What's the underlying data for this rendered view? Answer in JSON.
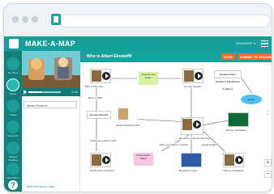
{
  "app": {
    "title": "MAKE-A-MAP",
    "map_title": "Who is Albert Einstein?",
    "buttons": {
      "save": "SAVE",
      "submit": "SUBMIT TO TEACHER"
    },
    "topbar_right": "BRAINPOP ▾"
  },
  "left_panel": {
    "video_time": "2:34",
    "search_value": "Albert Einstein",
    "add_to_map": "Add Movies to map"
  },
  "rail": [
    {
      "label": "My Maps"
    },
    {
      "label": "Movie"
    },
    {
      "label": "Images"
    },
    {
      "label": "Keywords"
    },
    {
      "label": "Related Reading"
    },
    {
      "label": "Word Bank"
    }
  ],
  "nodes": [
    {
      "text": "Born in Germany"
    },
    {
      "text": "physicist and author"
    },
    {
      "text": "his own theories"
    },
    {
      "text": "General Relativity"
    },
    {
      "text": "Special Relativity"
    },
    {
      "text": "Photoelectric Effect"
    },
    {
      "text": "Brownian motion"
    },
    {
      "text": "Theory of Relativity"
    },
    {
      "text": "Nobel Prize in Physics"
    },
    {
      "text": "Einstein's Quantum Theories"
    },
    {
      "text": "Energy and Matter"
    }
  ],
  "notes": [
    {
      "text": "physicist and author"
    },
    {
      "text": "Einstein's Nobel Prize"
    },
    {
      "text": "Photoelectric Effect"
    }
  ],
  "links": [
    {
      "text": "Born in 1879"
    },
    {
      "text": "taught himself physics"
    },
    {
      "text": "worked as a patent clerk"
    },
    {
      "text": "light not a wave or particle"
    },
    {
      "text": "explained movement of particles"
    },
    {
      "text": "speed of light"
    }
  ],
  "ellipses": [
    {
      "text": "Explains Albert Einstein's Significance in History"
    },
    {
      "text": "gravity"
    }
  ],
  "map_controls": {
    "zoom_in": "+",
    "zoom_out": "−"
  },
  "colors": {
    "teal": "#159f9a",
    "orange": "#f26b2e",
    "note": "#d7f2a0",
    "ellipse": "#4cc1f2"
  }
}
